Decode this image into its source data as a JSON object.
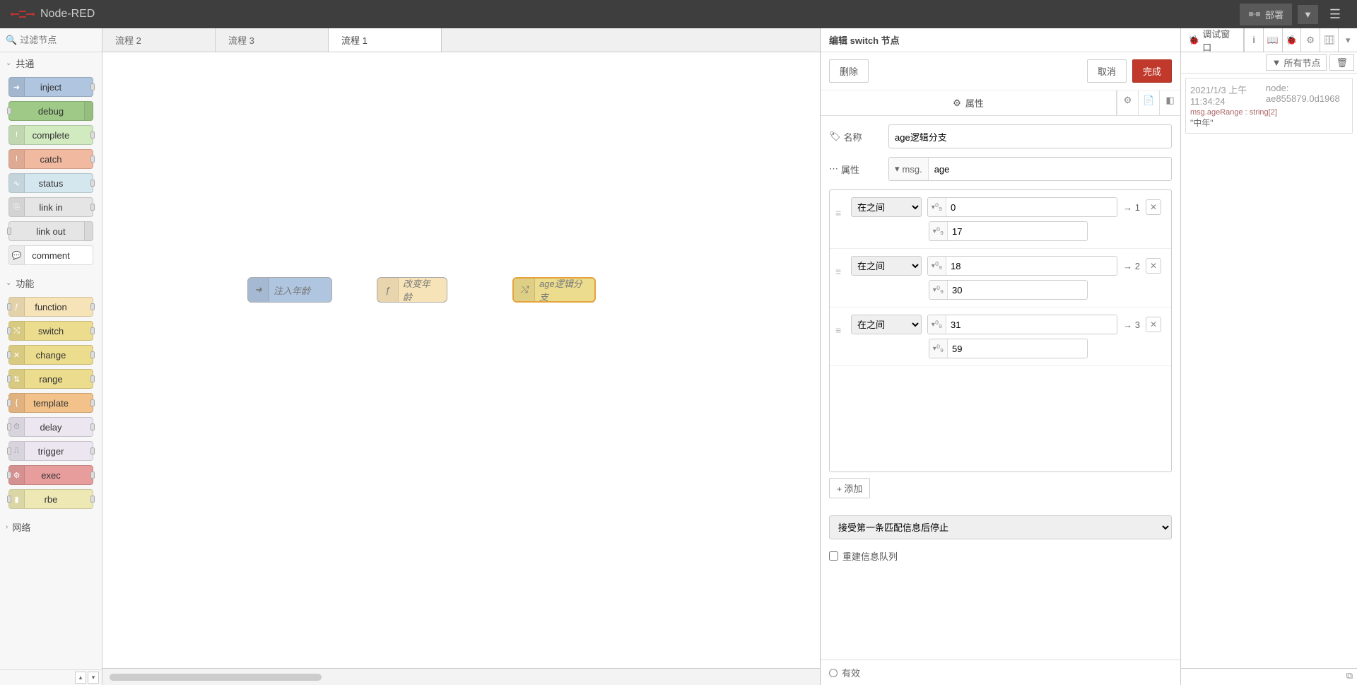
{
  "header": {
    "title": "Node-RED",
    "deploy": "部署"
  },
  "palette": {
    "search_placeholder": "过滤节点",
    "categories": {
      "common": "共通",
      "function": "功能",
      "network": "网络"
    },
    "nodes": {
      "inject": "inject",
      "debug": "debug",
      "complete": "complete",
      "catch": "catch",
      "status": "status",
      "link_in": "link in",
      "link_out": "link out",
      "comment": "comment",
      "function": "function",
      "switch": "switch",
      "change": "change",
      "range": "range",
      "template": "template",
      "delay": "delay",
      "trigger": "trigger",
      "exec": "exec",
      "rbe": "rbe"
    }
  },
  "tabs": {
    "flow2": "流程 2",
    "flow3": "流程 3",
    "flow1": "流程 1"
  },
  "canvas": {
    "node1": "注入年龄",
    "node2": "改变年龄",
    "node3": "age逻辑分支"
  },
  "editor": {
    "title": "编辑 switch 节点",
    "delete": "删除",
    "cancel": "取消",
    "done": "完成",
    "tab_properties": "属性",
    "label_name": "名称",
    "label_property": "属性",
    "name_value": "age逻辑分支",
    "prop_prefix": "msg.",
    "prop_value": "age",
    "rule_op": "在之间",
    "num_label": "⁰₉",
    "arrow": "→",
    "rules": [
      {
        "v1": "0",
        "v2": "17",
        "out": "1"
      },
      {
        "v1": "18",
        "v2": "30",
        "out": "2"
      },
      {
        "v1": "31",
        "v2": "59",
        "out": "3"
      }
    ],
    "add": "添加",
    "stop_option": "接受第一条匹配信息后停止",
    "recreate": "重建信息队列",
    "enabled": "有效"
  },
  "sidebar": {
    "debug_tab": "调试窗口",
    "filter": "所有节点",
    "msg": {
      "time": "2021/1/3 上午11:34:24",
      "node": "node: ae855879.0d1968",
      "topic": "msg.ageRange : string[2]",
      "value": "\"中年\""
    }
  }
}
